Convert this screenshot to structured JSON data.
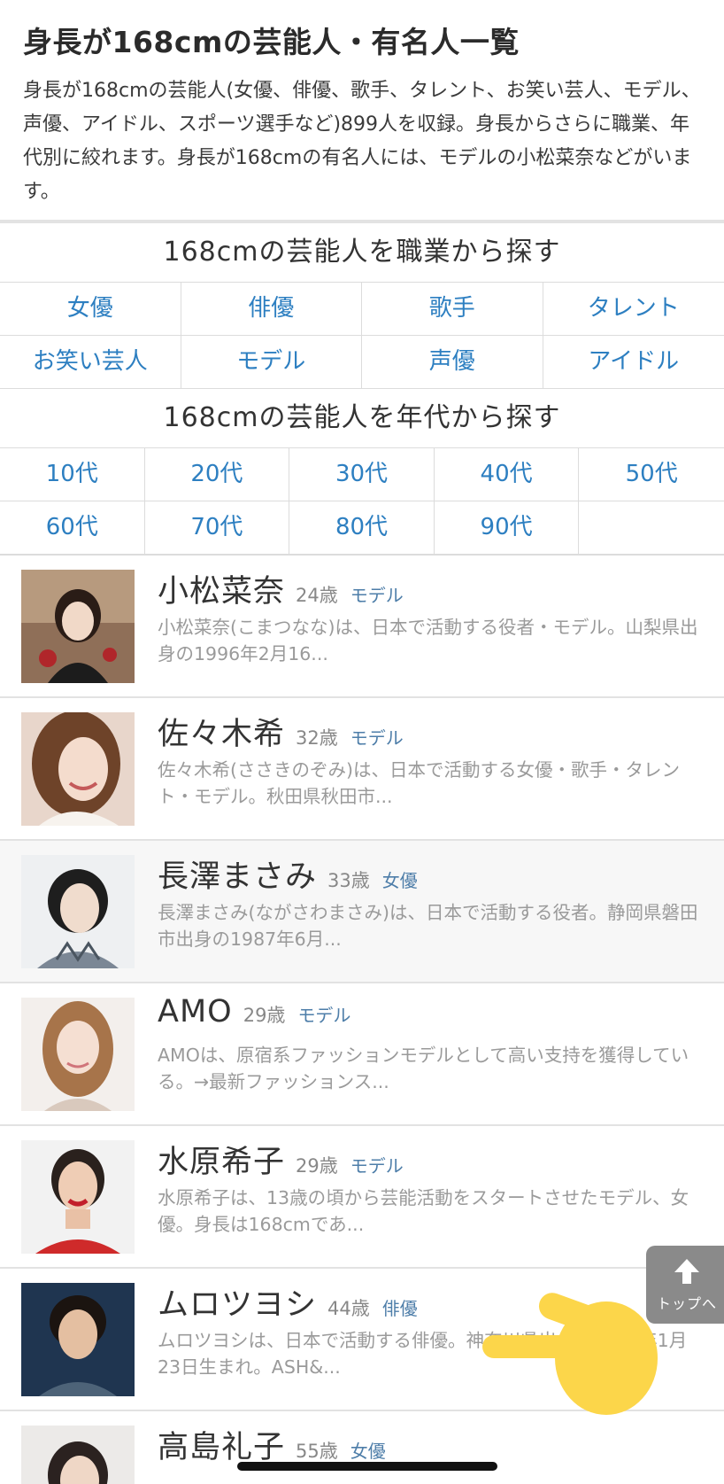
{
  "header": {
    "title": "身長が168cmの芸能人・有名人一覧",
    "intro": "身長が168cmの芸能人(女優、俳優、歌手、タレント、お笑い芸人、モデル、声優、アイドル、スポーツ選手など)899人を収録。身長からさらに職業、年代別に絞れます。身長が168cmの有名人には、モデルの小松菜奈などがいます。"
  },
  "occupation_section": {
    "heading": "168cmの芸能人を職業から探す",
    "items": [
      "女優",
      "俳優",
      "歌手",
      "タレント",
      "お笑い芸人",
      "モデル",
      "声優",
      "アイドル"
    ]
  },
  "age_section": {
    "heading": "168cmの芸能人を年代から探す",
    "items": [
      "10代",
      "20代",
      "30代",
      "40代",
      "50代",
      "60代",
      "70代",
      "80代",
      "90代",
      ""
    ]
  },
  "people": [
    {
      "name": "小松菜奈",
      "age": "24歳",
      "job": "モデル",
      "desc": "小松菜奈(こまつなな)は、日本で活動する役者・モデル。山梨県出身の1996年2月16..."
    },
    {
      "name": "佐々木希",
      "age": "32歳",
      "job": "モデル",
      "desc": "佐々木希(ささきのぞみ)は、日本で活動する女優・歌手・タレント・モデル。秋田県秋田市..."
    },
    {
      "name": "長澤まさみ",
      "age": "33歳",
      "job": "女優",
      "desc": "長澤まさみ(ながさわまさみ)は、日本で活動する役者。静岡県磐田市出身の1987年6月..."
    },
    {
      "name": "AMO",
      "age": "29歳",
      "job": "モデル",
      "desc": "AMOは、原宿系ファッションモデルとして高い支持を獲得している。→最新ファッションス..."
    },
    {
      "name": "水原希子",
      "age": "29歳",
      "job": "モデル",
      "desc": "水原希子は、13歳の頃から芸能活動をスタートさせたモデル、女優。身長は168cmであ..."
    },
    {
      "name": "ムロツヨシ",
      "age": "44歳",
      "job": "俳優",
      "desc": "ムロツヨシは、日本で活動する俳優。神奈川県出身の1976年1月23日生まれ。ASH&..."
    },
    {
      "name": "高島礼子",
      "age": "55歳",
      "job": "女優",
      "desc": ""
    }
  ],
  "to_top": {
    "label": "トップへ"
  },
  "colors": {
    "link": "#2d7fc1",
    "job": "#4e7ea9",
    "desc": "#9a9a9a",
    "hand": "#fcd64a"
  },
  "icons": [
    "arrow-up-icon",
    "pointing-hand-icon"
  ]
}
